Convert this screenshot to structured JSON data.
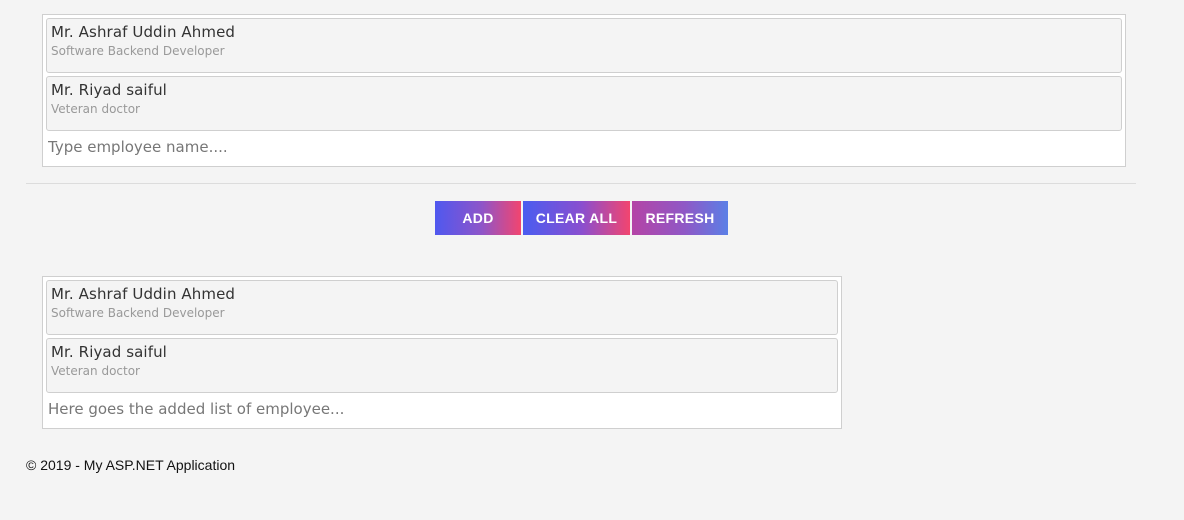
{
  "top_list": {
    "chips": [
      {
        "name": "Mr. Ashraf Uddin Ahmed",
        "role": "Software Backend Developer"
      },
      {
        "name": "Mr. Riyad saiful",
        "role": "Veteran doctor"
      }
    ],
    "input_placeholder": "Type employee name...."
  },
  "buttons": {
    "add_label": "ADD",
    "clear_all_label": "CLEAR ALL",
    "refresh_label": "REFRESH"
  },
  "bottom_list": {
    "chips": [
      {
        "name": "Mr. Ashraf Uddin Ahmed",
        "role": "Software Backend Developer"
      },
      {
        "name": "Mr. Riyad saiful",
        "role": "Veteran doctor"
      }
    ],
    "input_placeholder": "Here goes the added list of employee..."
  },
  "footer": {
    "text": "© 2019 - My ASP.NET Application"
  },
  "colors": {
    "background": "#f4f4f4",
    "chip_background": "#f4f4f4",
    "border": "#cfcfcf",
    "gradient_blue": "#4f58ef",
    "gradient_pink": "#f2456f"
  }
}
